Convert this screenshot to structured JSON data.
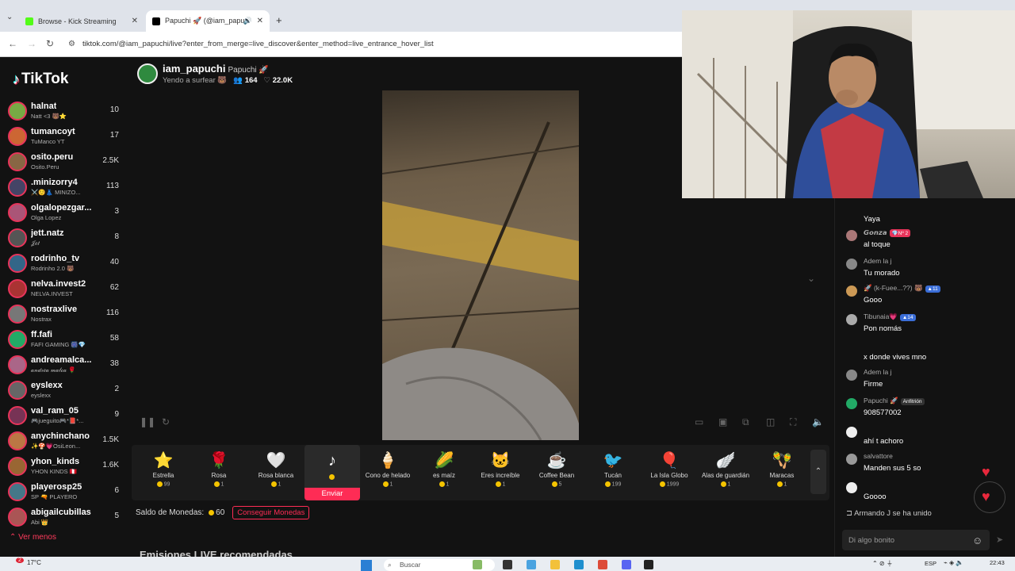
{
  "browser": {
    "tabs": [
      {
        "label": "Browse - Kick Streaming",
        "favicon_color": "#53fc18"
      },
      {
        "label": "Papuchi 🚀 (@iam_papuch",
        "favicon_color": "#000000"
      }
    ],
    "url": "tiktok.com/@iam_papuchi/live?enter_from_merge=live_discover&enter_method=live_entrance_hover_list"
  },
  "sidebar": {
    "logo": "TikTok",
    "items": [
      {
        "name": "halnat",
        "sub": "Natt <3 🐻⭐",
        "count": "10"
      },
      {
        "name": "tumancoyt",
        "sub": "TuManco YT",
        "count": "17"
      },
      {
        "name": "osito.peru",
        "sub": "Osito.Peru",
        "count": "2.5K"
      },
      {
        "name": ".minizorry4",
        "sub": "⚔️☺️👗 MINIZO...",
        "count": "113"
      },
      {
        "name": "olgalopezgar...",
        "sub": "Olga Lopez",
        "count": "3"
      },
      {
        "name": "jett.natz",
        "sub": "𝒥𝑒𝓉",
        "count": "8"
      },
      {
        "name": "rodrinho_tv",
        "sub": "Rodrinho 2.0 🐻",
        "count": "40"
      },
      {
        "name": "nelva.invest2",
        "sub": "NELVA.INVEST",
        "count": "62"
      },
      {
        "name": "nostraxlive",
        "sub": "Nostrax",
        "count": "116"
      },
      {
        "name": "ff.fafi",
        "sub": "FAFI GAMING 🎆💎",
        "count": "58"
      },
      {
        "name": "andreamalca...",
        "sub": "𝒶𝓃𝒹𝓇𝑒𝒶 𝓂𝒶𝓁𝒸𝒶 🌹",
        "count": "38"
      },
      {
        "name": "eyslexx",
        "sub": "eyslexx",
        "count": "2"
      },
      {
        "name": "val_ram_05",
        "sub": "🎮jueguito🎮*📕*...",
        "count": "9"
      },
      {
        "name": "anychinchano",
        "sub": "✨🍄💗OsiLeon...",
        "count": "1.5K"
      },
      {
        "name": "yhon_kinds",
        "sub": "YHON KINDS 🇵🇪",
        "count": "1.6K"
      },
      {
        "name": "playerosp25",
        "sub": "SP 🔫 PLAYERO",
        "count": "6"
      },
      {
        "name": "abigailcubillas",
        "sub": "Abi 👑",
        "count": "5"
      }
    ],
    "see_less": "Ver menos"
  },
  "stream": {
    "username": "iam_papuchi",
    "nickname": "Papuchi 🚀",
    "title": "Yendo a surfear 🐻",
    "viewers": "164",
    "likes": "22.0K"
  },
  "gifts": {
    "items": [
      {
        "name": "Estrella",
        "price": "99",
        "icon": "⭐"
      },
      {
        "name": "Rosa",
        "price": "1",
        "icon": "🌹"
      },
      {
        "name": "Rosa blanca",
        "price": "1",
        "icon": "🤍"
      },
      {
        "name": "",
        "price": "",
        "icon": "♪"
      },
      {
        "name": "Cono de helado",
        "price": "1",
        "icon": "🍦"
      },
      {
        "name": "es maíz",
        "price": "1",
        "icon": "🌽"
      },
      {
        "name": "Eres increíble",
        "price": "1",
        "icon": "🐱"
      },
      {
        "name": "Coffee Bean",
        "price": "5",
        "icon": "☕"
      },
      {
        "name": "Tucán",
        "price": "199",
        "icon": "🐦"
      },
      {
        "name": "La Isla Globo",
        "price": "1999",
        "icon": "🎈"
      },
      {
        "name": "Alas de guardián",
        "price": "1",
        "icon": "🪽"
      },
      {
        "name": "Maracas",
        "price": "1",
        "icon": "🪇"
      }
    ],
    "send_label": "Enviar"
  },
  "wallet": {
    "label": "Saldo de Monedas:",
    "amount": "60",
    "get_coins": "Conseguir Monedas"
  },
  "recommended_heading": "Emisiones LIVE recomendadas",
  "chat": {
    "messages": [
      {
        "user": "",
        "text": "Yaya",
        "badge": "",
        "badge_color": ""
      },
      {
        "user": "𝙂𝙤𝙣𝙯𝙖",
        "text": "al toque",
        "badge": "💎Nº 2",
        "badge_color": "#e8345a"
      },
      {
        "user": "Adem la j",
        "text": "Tu morado",
        "badge": "",
        "badge_color": ""
      },
      {
        "user": "🚀 (k-Fuee...??) 🐻",
        "text": "Gooo",
        "badge": "▲11",
        "badge_color": "#3b6ed8"
      },
      {
        "user": "Tibunaia💗",
        "text": "Pon nomás",
        "badge": "▲14",
        "badge_color": "#3b6ed8"
      },
      {
        "user": "",
        "text": "x donde vives mno",
        "badge": "",
        "badge_color": ""
      },
      {
        "user": "Adem la j",
        "text": "Firme",
        "badge": "",
        "badge_color": ""
      },
      {
        "user": "Papuchi 🚀",
        "text": "908577002",
        "badge": "Anfitrión",
        "badge_color": "#333333"
      },
      {
        "user": "",
        "text": "ahí t achoro",
        "badge": "",
        "badge_color": ""
      },
      {
        "user": "salvattore",
        "text": "Manden sus 5 so",
        "badge": "",
        "badge_color": ""
      },
      {
        "user": "",
        "text": "Goooo",
        "badge": "",
        "badge_color": ""
      }
    ],
    "join_notice": "Armando J se ha unido",
    "input_placeholder": "Di algo bonito"
  },
  "taskbar": {
    "weather": "17°C",
    "notifications": "2",
    "search_placeholder": "Buscar",
    "language": "ESP",
    "time": "22:43"
  },
  "colors": {
    "accent": "#fe2c55",
    "coin": "#f5c400",
    "background": "#121212"
  }
}
